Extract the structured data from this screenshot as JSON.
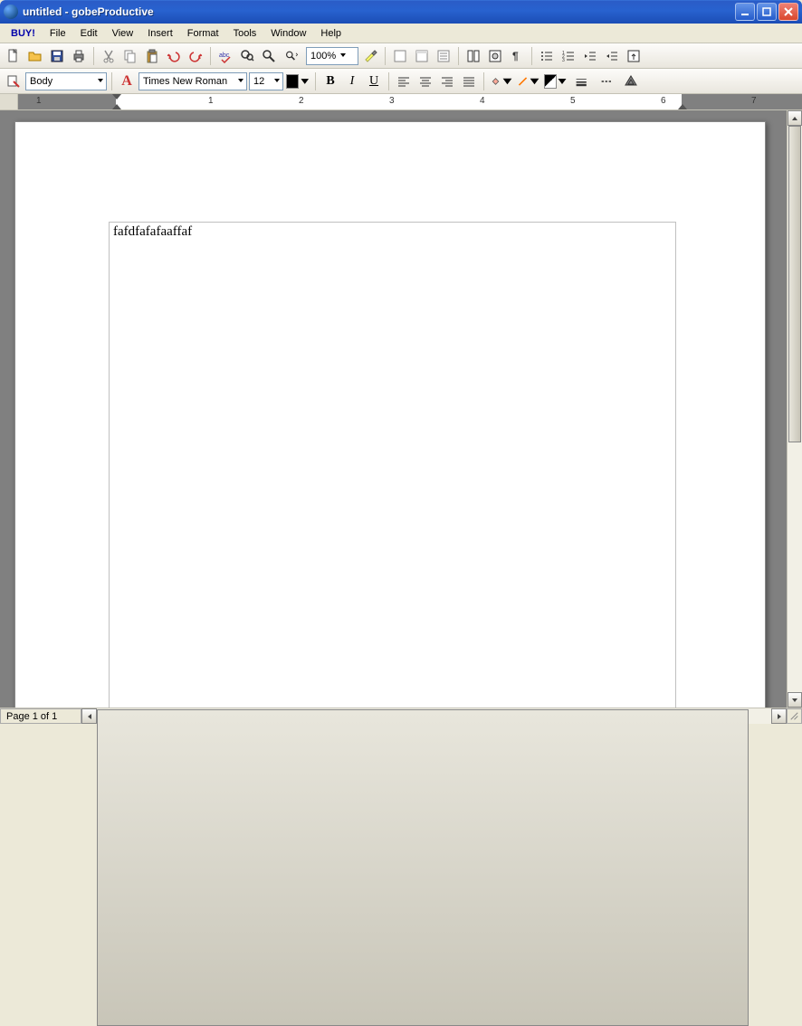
{
  "window": {
    "title": "untitled - gobeProductive"
  },
  "menu": {
    "buy": "BUY!",
    "file": "File",
    "edit": "Edit",
    "view": "View",
    "insert": "Insert",
    "format": "Format",
    "tools": "Tools",
    "window": "Window",
    "help": "Help"
  },
  "toolbar1": {
    "zoom": "100%"
  },
  "toolbar2": {
    "style": "Body",
    "font": "Times New Roman",
    "size": "12"
  },
  "ruler": {
    "n1": "1",
    "n2": "2",
    "n3": "3",
    "n4": "4",
    "n5": "5",
    "n6": "6",
    "n7": "7"
  },
  "document": {
    "text": "fafdfafafaaffaf"
  },
  "status": {
    "page": "Page 1 of 1"
  }
}
